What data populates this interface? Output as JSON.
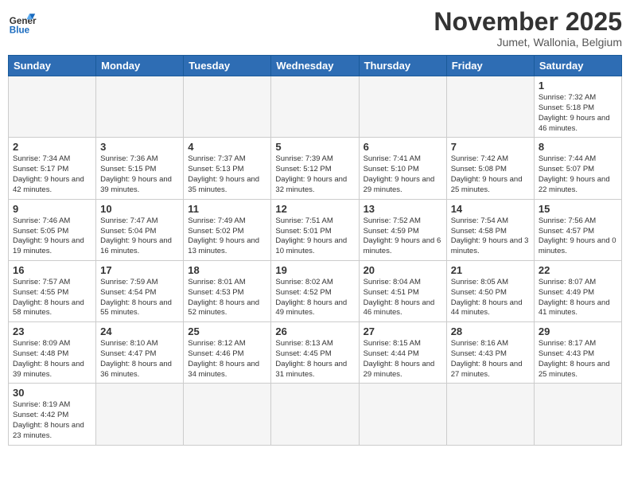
{
  "header": {
    "logo_general": "General",
    "logo_blue": "Blue",
    "month_title": "November 2025",
    "location": "Jumet, Wallonia, Belgium"
  },
  "days_of_week": [
    "Sunday",
    "Monday",
    "Tuesday",
    "Wednesday",
    "Thursday",
    "Friday",
    "Saturday"
  ],
  "weeks": [
    [
      {
        "day": "",
        "info": ""
      },
      {
        "day": "",
        "info": ""
      },
      {
        "day": "",
        "info": ""
      },
      {
        "day": "",
        "info": ""
      },
      {
        "day": "",
        "info": ""
      },
      {
        "day": "",
        "info": ""
      },
      {
        "day": "1",
        "info": "Sunrise: 7:32 AM\nSunset: 5:18 PM\nDaylight: 9 hours and 46 minutes."
      }
    ],
    [
      {
        "day": "2",
        "info": "Sunrise: 7:34 AM\nSunset: 5:17 PM\nDaylight: 9 hours and 42 minutes."
      },
      {
        "day": "3",
        "info": "Sunrise: 7:36 AM\nSunset: 5:15 PM\nDaylight: 9 hours and 39 minutes."
      },
      {
        "day": "4",
        "info": "Sunrise: 7:37 AM\nSunset: 5:13 PM\nDaylight: 9 hours and 35 minutes."
      },
      {
        "day": "5",
        "info": "Sunrise: 7:39 AM\nSunset: 5:12 PM\nDaylight: 9 hours and 32 minutes."
      },
      {
        "day": "6",
        "info": "Sunrise: 7:41 AM\nSunset: 5:10 PM\nDaylight: 9 hours and 29 minutes."
      },
      {
        "day": "7",
        "info": "Sunrise: 7:42 AM\nSunset: 5:08 PM\nDaylight: 9 hours and 25 minutes."
      },
      {
        "day": "8",
        "info": "Sunrise: 7:44 AM\nSunset: 5:07 PM\nDaylight: 9 hours and 22 minutes."
      }
    ],
    [
      {
        "day": "9",
        "info": "Sunrise: 7:46 AM\nSunset: 5:05 PM\nDaylight: 9 hours and 19 minutes."
      },
      {
        "day": "10",
        "info": "Sunrise: 7:47 AM\nSunset: 5:04 PM\nDaylight: 9 hours and 16 minutes."
      },
      {
        "day": "11",
        "info": "Sunrise: 7:49 AM\nSunset: 5:02 PM\nDaylight: 9 hours and 13 minutes."
      },
      {
        "day": "12",
        "info": "Sunrise: 7:51 AM\nSunset: 5:01 PM\nDaylight: 9 hours and 10 minutes."
      },
      {
        "day": "13",
        "info": "Sunrise: 7:52 AM\nSunset: 4:59 PM\nDaylight: 9 hours and 6 minutes."
      },
      {
        "day": "14",
        "info": "Sunrise: 7:54 AM\nSunset: 4:58 PM\nDaylight: 9 hours and 3 minutes."
      },
      {
        "day": "15",
        "info": "Sunrise: 7:56 AM\nSunset: 4:57 PM\nDaylight: 9 hours and 0 minutes."
      }
    ],
    [
      {
        "day": "16",
        "info": "Sunrise: 7:57 AM\nSunset: 4:55 PM\nDaylight: 8 hours and 58 minutes."
      },
      {
        "day": "17",
        "info": "Sunrise: 7:59 AM\nSunset: 4:54 PM\nDaylight: 8 hours and 55 minutes."
      },
      {
        "day": "18",
        "info": "Sunrise: 8:01 AM\nSunset: 4:53 PM\nDaylight: 8 hours and 52 minutes."
      },
      {
        "day": "19",
        "info": "Sunrise: 8:02 AM\nSunset: 4:52 PM\nDaylight: 8 hours and 49 minutes."
      },
      {
        "day": "20",
        "info": "Sunrise: 8:04 AM\nSunset: 4:51 PM\nDaylight: 8 hours and 46 minutes."
      },
      {
        "day": "21",
        "info": "Sunrise: 8:05 AM\nSunset: 4:50 PM\nDaylight: 8 hours and 44 minutes."
      },
      {
        "day": "22",
        "info": "Sunrise: 8:07 AM\nSunset: 4:49 PM\nDaylight: 8 hours and 41 minutes."
      }
    ],
    [
      {
        "day": "23",
        "info": "Sunrise: 8:09 AM\nSunset: 4:48 PM\nDaylight: 8 hours and 39 minutes."
      },
      {
        "day": "24",
        "info": "Sunrise: 8:10 AM\nSunset: 4:47 PM\nDaylight: 8 hours and 36 minutes."
      },
      {
        "day": "25",
        "info": "Sunrise: 8:12 AM\nSunset: 4:46 PM\nDaylight: 8 hours and 34 minutes."
      },
      {
        "day": "26",
        "info": "Sunrise: 8:13 AM\nSunset: 4:45 PM\nDaylight: 8 hours and 31 minutes."
      },
      {
        "day": "27",
        "info": "Sunrise: 8:15 AM\nSunset: 4:44 PM\nDaylight: 8 hours and 29 minutes."
      },
      {
        "day": "28",
        "info": "Sunrise: 8:16 AM\nSunset: 4:43 PM\nDaylight: 8 hours and 27 minutes."
      },
      {
        "day": "29",
        "info": "Sunrise: 8:17 AM\nSunset: 4:43 PM\nDaylight: 8 hours and 25 minutes."
      }
    ],
    [
      {
        "day": "30",
        "info": "Sunrise: 8:19 AM\nSunset: 4:42 PM\nDaylight: 8 hours and 23 minutes."
      },
      {
        "day": "",
        "info": ""
      },
      {
        "day": "",
        "info": ""
      },
      {
        "day": "",
        "info": ""
      },
      {
        "day": "",
        "info": ""
      },
      {
        "day": "",
        "info": ""
      },
      {
        "day": "",
        "info": ""
      }
    ]
  ]
}
